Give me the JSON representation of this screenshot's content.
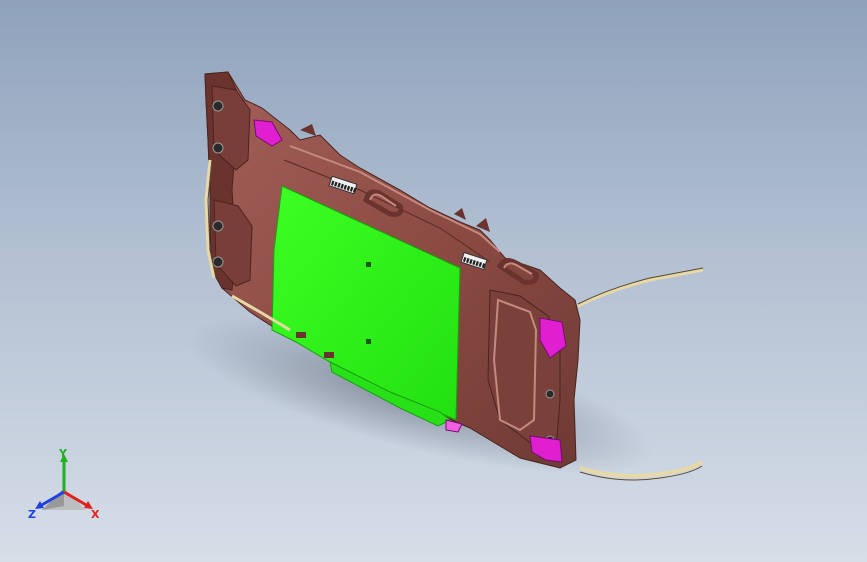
{
  "viewport": {
    "background_top": "#8fa2bc",
    "background_bottom": "#d6dee8"
  },
  "model": {
    "body_color": "#8a4a42",
    "body_shade": "#6a332e",
    "body_highlight": "#b57a70",
    "face_color": "#22ee11",
    "clip_color": "#e020d0",
    "wire_color": "#e8d8a8",
    "vent_left_text": "▮▮▮▮▮▮▮▮",
    "vent_right_text": "▮▮▮▮▮▮▮"
  },
  "triad": {
    "x_label": "X",
    "y_label": "Y",
    "z_label": "Z",
    "x_color": "#e02020",
    "y_color": "#20b020",
    "z_color": "#2040e0"
  }
}
